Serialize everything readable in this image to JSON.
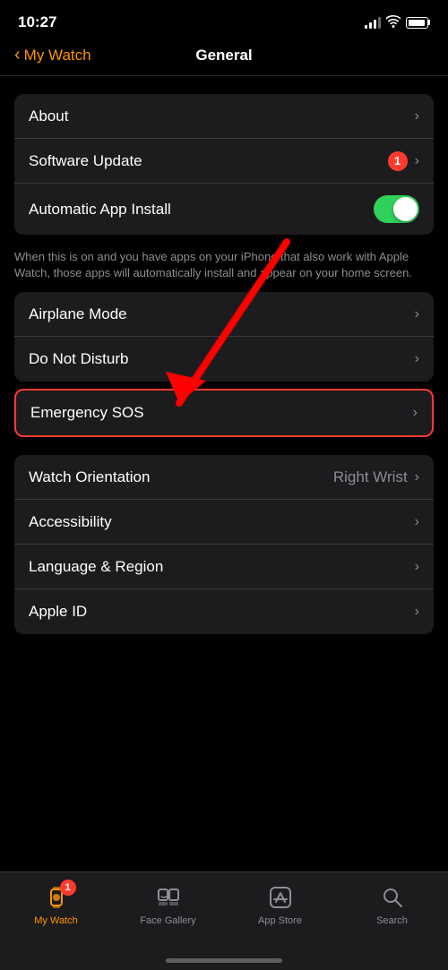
{
  "statusBar": {
    "time": "10:27",
    "battery": 85
  },
  "header": {
    "backLabel": "My Watch",
    "title": "General"
  },
  "sections": [
    {
      "id": "top",
      "rows": [
        {
          "id": "about",
          "label": "About",
          "value": "",
          "hasChevron": true,
          "hasBadge": false,
          "hasToggle": false
        },
        {
          "id": "software-update",
          "label": "Software Update",
          "value": "",
          "hasChevron": true,
          "hasBadge": true,
          "badgeCount": "1",
          "hasToggle": false
        },
        {
          "id": "automatic-app-install",
          "label": "Automatic App Install",
          "value": "",
          "hasChevron": false,
          "hasBadge": false,
          "hasToggle": true,
          "toggleOn": true
        }
      ],
      "description": "When this is on and you have apps on your iPhone that also work with Apple Watch, those apps will automatically install and appear on your home screen."
    },
    {
      "id": "middle",
      "rows": [
        {
          "id": "airplane-mode",
          "label": "Airplane Mode",
          "value": "",
          "hasChevron": true,
          "hasBadge": false,
          "hasToggle": false
        },
        {
          "id": "do-not-disturb",
          "label": "Do Not Disturb",
          "value": "",
          "hasChevron": true,
          "hasBadge": false,
          "hasToggle": false
        }
      ]
    },
    {
      "id": "emergency",
      "isHighlighted": true,
      "rows": [
        {
          "id": "emergency-sos",
          "label": "Emergency SOS",
          "value": "",
          "hasChevron": true,
          "hasBadge": false,
          "hasToggle": false
        }
      ]
    },
    {
      "id": "bottom",
      "rows": [
        {
          "id": "watch-orientation",
          "label": "Watch Orientation",
          "value": "Right Wrist",
          "hasChevron": true,
          "hasBadge": false,
          "hasToggle": false
        },
        {
          "id": "accessibility",
          "label": "Accessibility",
          "value": "",
          "hasChevron": true,
          "hasBadge": false,
          "hasToggle": false
        },
        {
          "id": "language-region",
          "label": "Language & Region",
          "value": "",
          "hasChevron": true,
          "hasBadge": false,
          "hasToggle": false
        },
        {
          "id": "apple-id",
          "label": "Apple ID",
          "value": "",
          "hasChevron": true,
          "hasBadge": false,
          "hasToggle": false
        }
      ]
    }
  ],
  "tabBar": {
    "items": [
      {
        "id": "my-watch",
        "label": "My Watch",
        "active": true,
        "badge": "1"
      },
      {
        "id": "face-gallery",
        "label": "Face Gallery",
        "active": false
      },
      {
        "id": "app-store",
        "label": "App Store",
        "active": false
      },
      {
        "id": "search",
        "label": "Search",
        "active": false
      }
    ]
  }
}
